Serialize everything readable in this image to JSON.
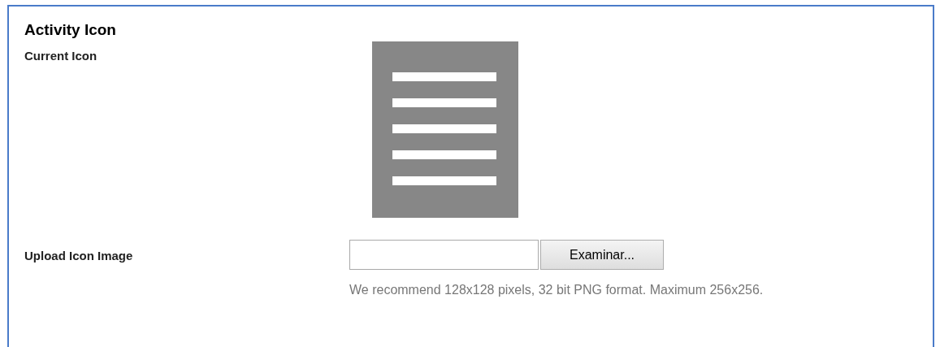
{
  "section": {
    "title": "Activity Icon"
  },
  "current_icon": {
    "label": "Current Icon"
  },
  "upload": {
    "label": "Upload Icon Image",
    "button": "Examinar...",
    "help": "We recommend 128x128 pixels, 32 bit PNG format. Maximum 256x256."
  }
}
